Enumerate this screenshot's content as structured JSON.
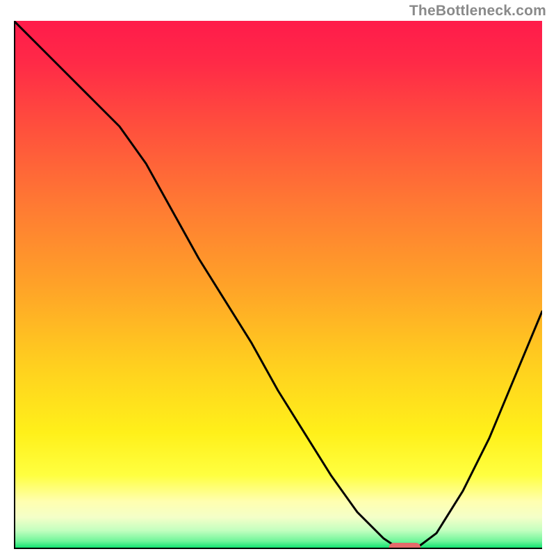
{
  "attribution": "TheBottleneck.com",
  "chart_data": {
    "type": "line",
    "title": "",
    "xlabel": "",
    "ylabel": "",
    "xlim": [
      0,
      100
    ],
    "ylim": [
      0,
      100
    ],
    "x": [
      0,
      5,
      10,
      15,
      20,
      25,
      30,
      35,
      40,
      45,
      50,
      55,
      60,
      65,
      70,
      73,
      76,
      80,
      85,
      90,
      95,
      100
    ],
    "values": [
      100,
      95,
      90,
      85,
      80,
      73,
      64,
      55,
      47,
      39,
      30,
      22,
      14,
      7,
      2,
      0,
      0,
      3,
      11,
      21,
      33,
      45
    ],
    "marker": {
      "x_start": 71,
      "x_end": 77,
      "y": 0
    },
    "gradient_stops": [
      {
        "offset": 0.0,
        "color": "#ff1b4b"
      },
      {
        "offset": 0.08,
        "color": "#ff2a47"
      },
      {
        "offset": 0.2,
        "color": "#ff4f3d"
      },
      {
        "offset": 0.35,
        "color": "#ff7a33"
      },
      {
        "offset": 0.5,
        "color": "#ffa228"
      },
      {
        "offset": 0.65,
        "color": "#ffcf1f"
      },
      {
        "offset": 0.78,
        "color": "#fff01a"
      },
      {
        "offset": 0.86,
        "color": "#ffff40"
      },
      {
        "offset": 0.91,
        "color": "#ffffb0"
      },
      {
        "offset": 0.94,
        "color": "#f4ffc8"
      },
      {
        "offset": 0.965,
        "color": "#c2ffbf"
      },
      {
        "offset": 0.985,
        "color": "#70f59a"
      },
      {
        "offset": 1.0,
        "color": "#00e06a"
      }
    ]
  }
}
